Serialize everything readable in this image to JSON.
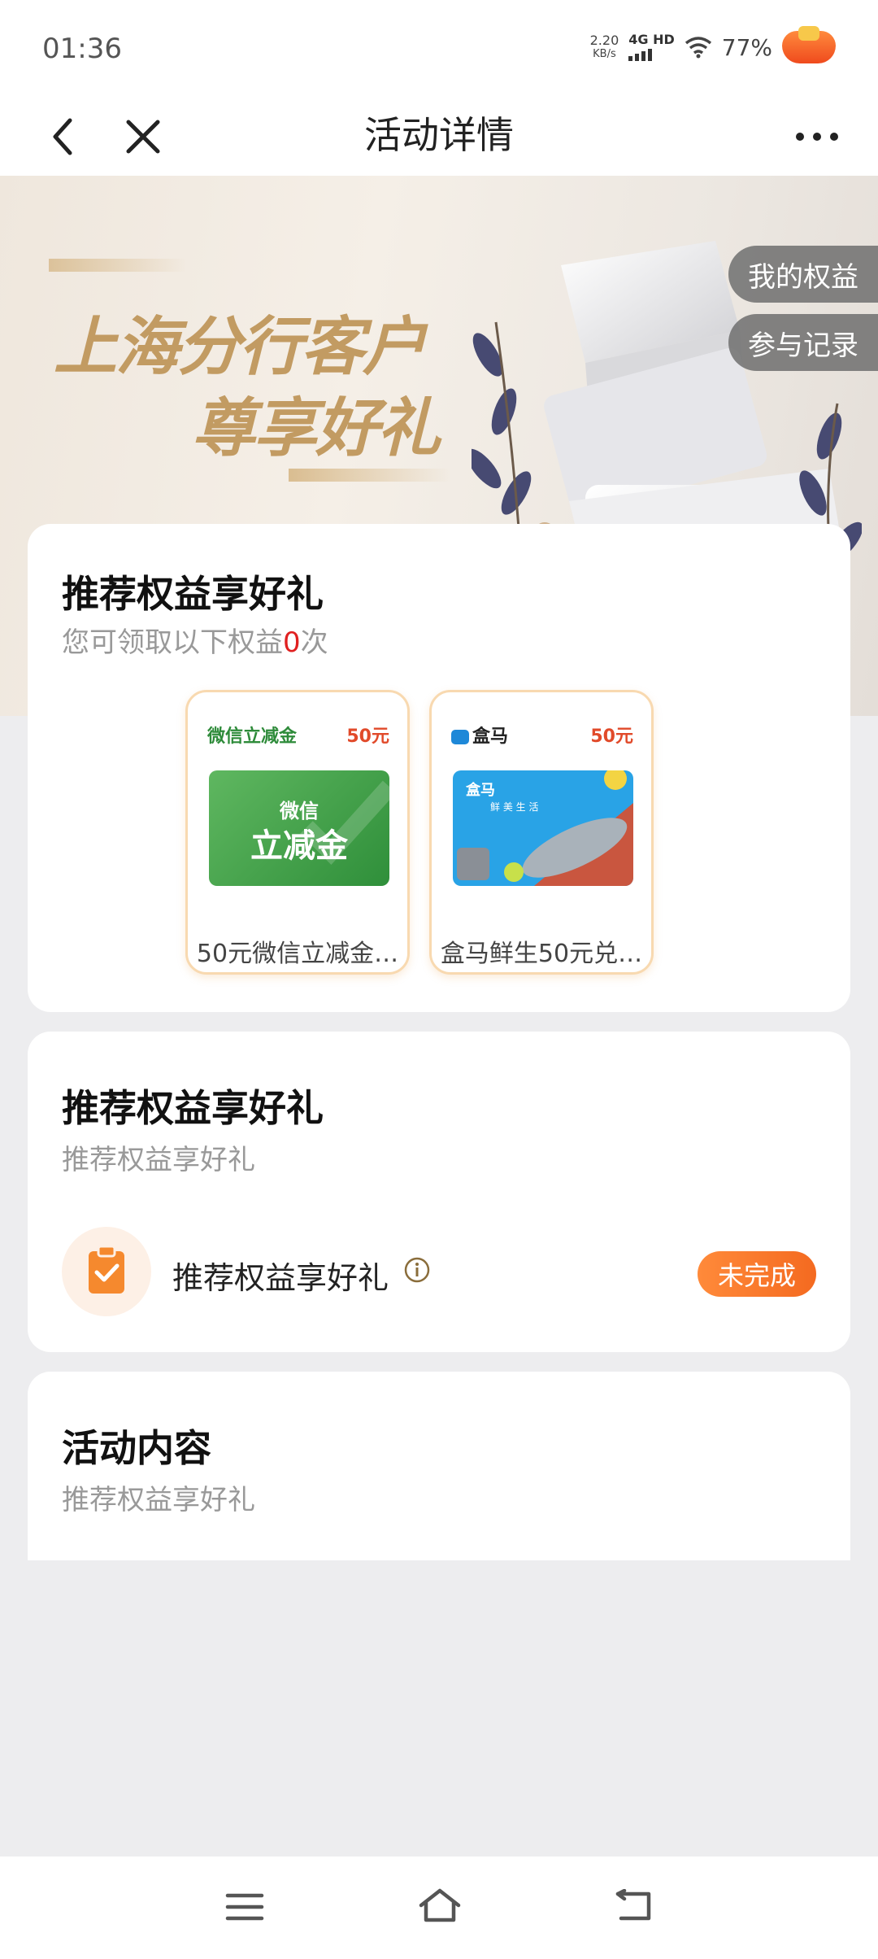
{
  "status_bar": {
    "time": "01:36",
    "net_speed_value": "2.20",
    "net_speed_unit": "KB/s",
    "network": "4G HD",
    "battery": "77%"
  },
  "nav": {
    "title": "活动详情"
  },
  "banner": {
    "line1": "上海分行客户",
    "line2": "尊享好礼",
    "my_benefits": "我的权益",
    "records": "参与记录"
  },
  "benefits_card": {
    "title": "推荐权益享好礼",
    "sub_prefix": "您可领取以下权益",
    "sub_count": "0",
    "sub_suffix": "次",
    "items": [
      {
        "brand": "微信立减金",
        "price": "50元",
        "image_text_top": "微信",
        "image_text_main": "立减金",
        "name": "50元微信立减金…",
        "brand_color": "#2e8b3a"
      },
      {
        "brand": "盒马",
        "price": "50元",
        "image_text_top": "盒马",
        "image_text_main": "鲜 美 生 活",
        "name": "盒马鲜生50元兑…",
        "brand_color": "#1e88d8"
      }
    ]
  },
  "task_card": {
    "title": "推荐权益享好礼",
    "subtitle": "推荐权益享好礼",
    "task_label": "推荐权益享好礼",
    "status": "未完成"
  },
  "content_card": {
    "title": "活动内容",
    "subtitle": "推荐权益享好礼"
  },
  "colors": {
    "accent_orange": "#f46a20",
    "gold_text": "#c29b62",
    "count_red": "#e02020"
  }
}
